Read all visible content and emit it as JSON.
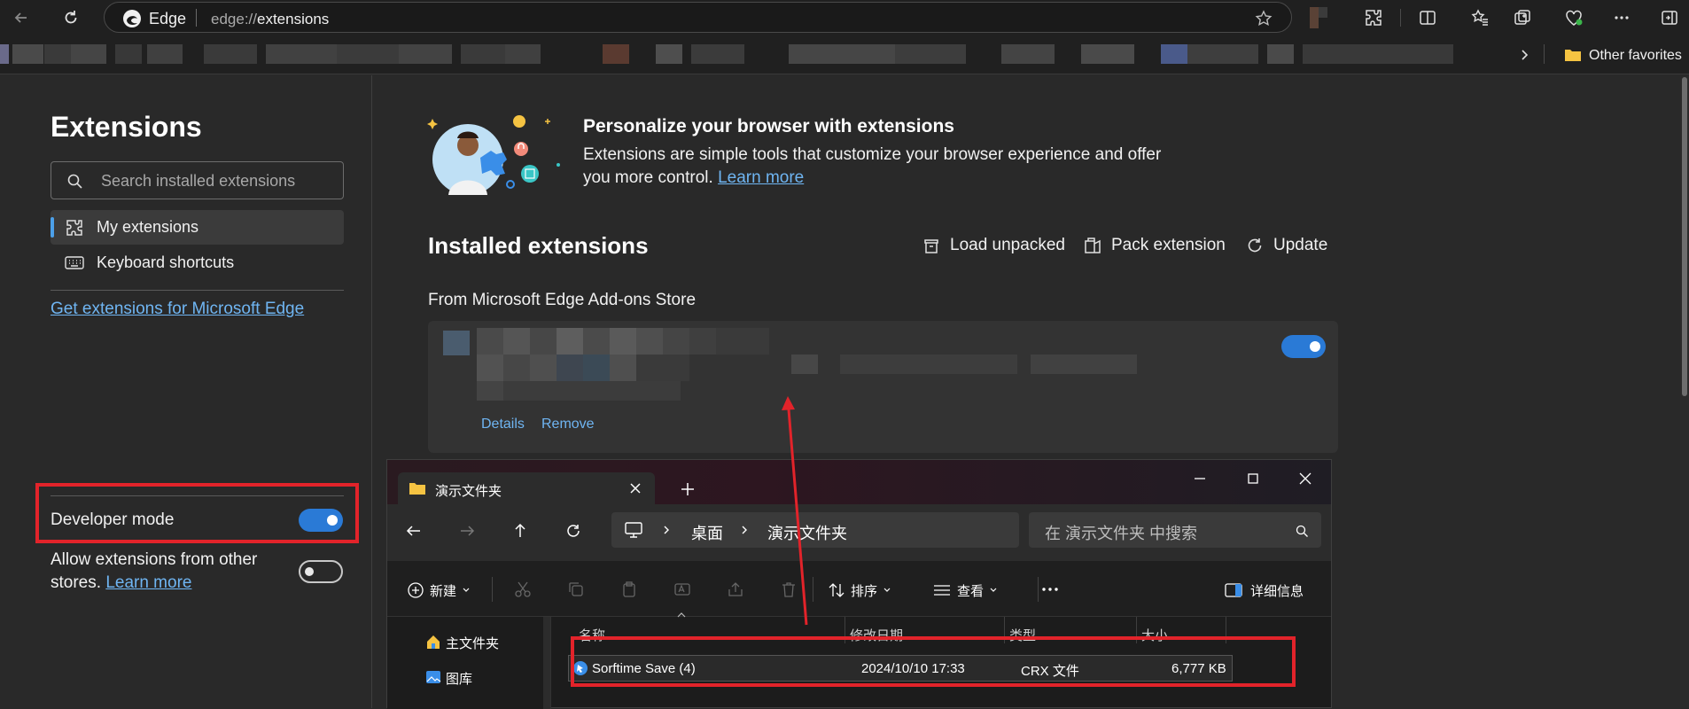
{
  "browser": {
    "brand": "Edge",
    "url_scheme": "edge://",
    "url_path": "extensions",
    "other_favorites": "Other favorites"
  },
  "sidebar": {
    "title": "Extensions",
    "search_placeholder": "Search installed extensions",
    "nav": [
      {
        "label": "My extensions",
        "selected": true
      },
      {
        "label": "Keyboard shortcuts",
        "selected": false
      }
    ],
    "get_extensions_link": "Get extensions for Microsoft Edge",
    "developer_mode_label": "Developer mode",
    "developer_mode_on": true,
    "allow_other_stores_text": "Allow extensions from other stores.",
    "allow_other_stores_link": "Learn more",
    "allow_other_stores_on": false
  },
  "main": {
    "hero_title": "Personalize your browser with extensions",
    "hero_desc": "Extensions are simple tools that customize your browser experience and offer you more control.",
    "hero_link": "Learn more",
    "installed_title": "Installed extensions",
    "actions": [
      "Load unpacked",
      "Pack extension",
      "Update"
    ],
    "store_section": "From Microsoft Edge Add-ons Store",
    "card": {
      "details": "Details",
      "remove": "Remove",
      "enabled": true
    }
  },
  "explorer": {
    "tab_title": "演示文件夹",
    "breadcrumb": [
      "桌面",
      "演示文件夹"
    ],
    "search_placeholder": "在 演示文件夹 中搜索",
    "commands": {
      "new": "新建",
      "sort": "排序",
      "view": "查看",
      "details": "详细信息"
    },
    "nav_items": [
      "主文件夹",
      "图库"
    ],
    "columns": [
      "名称",
      "修改日期",
      "类型",
      "大小"
    ],
    "files": [
      {
        "name": "Sorftime Save (4)",
        "modified": "2024/10/10 17:33",
        "type": "CRX 文件",
        "size": "6,777 KB"
      }
    ]
  },
  "colors": {
    "accent": "#2a7ad6",
    "link": "#6fb5f2",
    "annotation_red": "#e2232a"
  }
}
